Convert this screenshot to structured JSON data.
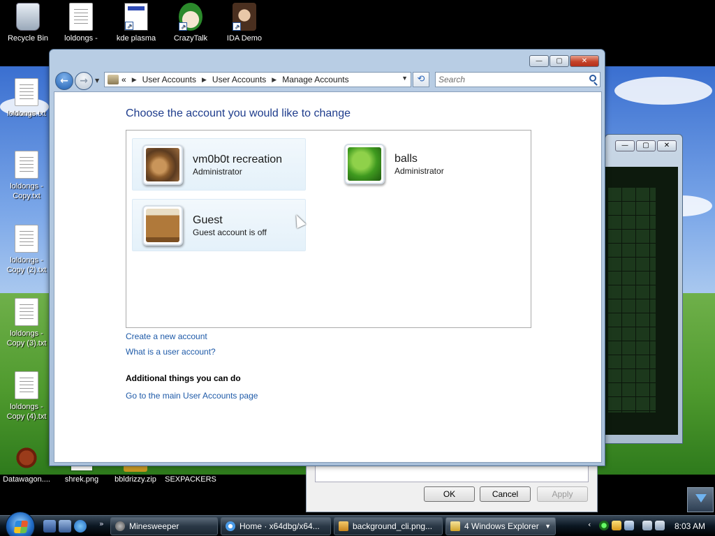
{
  "desktop": {
    "icons": [
      {
        "label": "Recycle Bin"
      },
      {
        "label": "loldongs -"
      },
      {
        "label": "kde plasma"
      },
      {
        "label": "CrazyTalk"
      },
      {
        "label": "IDA Demo"
      },
      {
        "label": "loldongs.txt"
      },
      {
        "label": "loldongs - Copy.txt"
      },
      {
        "label": "loldongs - Copy (2).txt"
      },
      {
        "label": "loldongs - Copy (3).txt"
      },
      {
        "label": "loldongs - Copy (4).txt"
      },
      {
        "label": "Datawagon...."
      },
      {
        "label": "shrek.png"
      },
      {
        "label": "bbldrizzy.zip"
      },
      {
        "label": "SEXPACKERS"
      }
    ]
  },
  "bg_dialog": {
    "ok": "OK",
    "cancel": "Cancel",
    "apply": "Apply"
  },
  "window": {
    "address": {
      "crumbs": [
        "User Accounts",
        "User Accounts",
        "Manage Accounts"
      ],
      "prefix": "«"
    },
    "search": {
      "placeholder": "Search"
    },
    "title": "Choose the account you would like to change",
    "accounts": [
      {
        "name": "vm0b0t recreation",
        "role": "Administrator"
      },
      {
        "name": "balls",
        "role": "Administrator"
      },
      {
        "name": "Guest",
        "role": "Guest account is off"
      }
    ],
    "links": {
      "create": "Create a new account",
      "what_is": "What is a user account?",
      "main_page": "Go to the main User Accounts page"
    },
    "additional_heading": "Additional things you can do"
  },
  "taskbar": {
    "tasks": [
      {
        "label": "Minesweeper"
      },
      {
        "label": "Home · x64dbg/x64..."
      },
      {
        "label": "background_cli.png..."
      },
      {
        "label": "4 Windows Explorer"
      }
    ],
    "clock": "8:03 AM"
  },
  "colors": {
    "link": "#1e5aa8",
    "title": "#1e3c8c"
  }
}
